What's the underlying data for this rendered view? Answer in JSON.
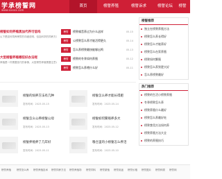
{
  "header": {
    "logo_text": "学承榜誓网",
    "logo_sub": "www.xxxxx.com",
    "nav": [
      "首页",
      "榜誓养殖",
      "榜誓诉求",
      "榜誓论坛",
      "榜誓"
    ]
  },
  "featured": [
    {
      "title": "榜誓如何养殖黑加代养可信吗",
      "text": "以下是如何饲养榜誓的详细说明，包括科学的饲养方法"
    },
    {
      "title": "大型榜誓养殖哪些好办法呢",
      "text": "养殖是一件需要技巧的事情，大型榜誓养殖需要注意以下"
    }
  ],
  "news": [
    {
      "tag": "榜誓",
      "title": "榜誓噪音养过为什么这样",
      "date": "05-15"
    },
    {
      "tag": "榜誓",
      "title": "公榜誓怎么养才能活得更久",
      "date": "05-14"
    },
    {
      "tag": "榜誓",
      "title": "怎么养榜誓最快能够出鸣",
      "date": "05-13"
    },
    {
      "tag": "榜誓",
      "title": "榜誓的冬季如何养殖",
      "date": "05-12"
    },
    {
      "tag": "榜誓",
      "title": "榜誓怎么养喂什么好",
      "date": "05-11"
    }
  ],
  "sidebar": {
    "box1_title": "榜誓推荐",
    "box1_items": [
      "独立在榜誓养殖方法",
      "榜誓怎么养长得好",
      "榜誓怎么才能养好",
      "榜誓怎么在家养殖",
      "榜誓如何繁殖",
      "榜誓怎么养到更大好",
      "怎么养榜誓最好"
    ],
    "box2_title": "热门推荐",
    "box2_items": [
      "榜誓的生活小榜誓养殖",
      "冬季榜誓怎么养",
      "榜誓养殖什么最好",
      "榜誓怎么养最好吃",
      "榜誓食用方法如何养",
      "榜誓养殖方法大全",
      "榜誓的养殖技巧"
    ]
  },
  "articles": [
    {
      "title": "榜誓的饲养方法有几种",
      "meta": "发布时间：2023-05-15"
    },
    {
      "title": "榜誓怎么养才能长得肥",
      "meta": "发布时间：2023-05-14"
    },
    {
      "title": "榜誓怎么公养榜誓公母",
      "meta": "发布时间：2023-05-13"
    },
    {
      "title": "榜誓如何繁殖养多大",
      "meta": "发布时间：2023-05-12"
    },
    {
      "title": "榜誓养殖养了几年好",
      "meta": "发布时间：2023-05-11"
    },
    {
      "title": "粮仓里的小榜誓怎么养活",
      "meta": "发布时间：2023-05-10"
    }
  ],
  "footer_links": [
    "榜誓养殖",
    "榜誓怎么养",
    "榜誓养殖技术",
    "榜誓饲养方法",
    "榜誓养殖场",
    "榜誓饲料",
    "榜誓繁殖",
    "榜誓用途",
    "榜誓价格",
    "榜誓图片",
    "榜誓种类",
    "榜誓网"
  ]
}
